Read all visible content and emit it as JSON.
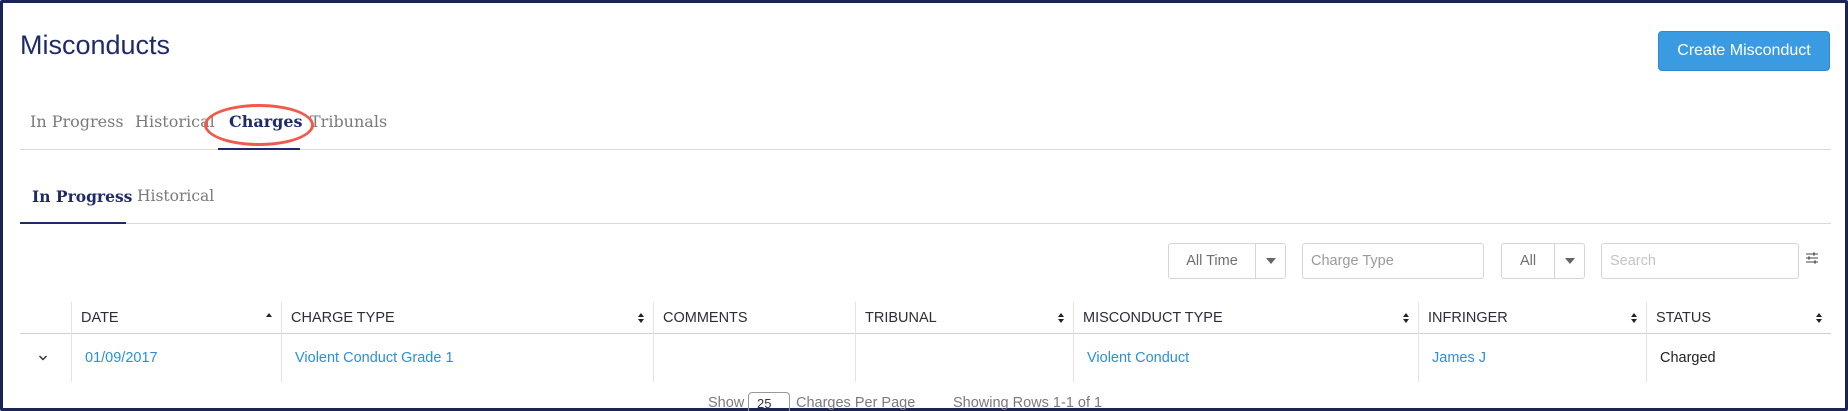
{
  "header": {
    "title": "Misconducts",
    "create_button": "Create Misconduct"
  },
  "primary_tabs": {
    "in_progress": "In Progress",
    "historical": "Historical",
    "charges": "Charges",
    "tribunals": "Tribunals",
    "active": "Charges"
  },
  "secondary_tabs": {
    "in_progress": "In Progress",
    "historical": "Historical",
    "active": "In Progress"
  },
  "filters": {
    "time_value": "All Time",
    "charge_type_placeholder": "Charge Type",
    "status_value": "All",
    "search_placeholder": "Search"
  },
  "table": {
    "columns": {
      "date": "DATE",
      "charge_type": "CHARGE TYPE",
      "comments": "COMMENTS",
      "tribunal": "TRIBUNAL",
      "misconduct_type": "MISCONDUCT TYPE",
      "infringer": "INFRINGER",
      "status": "STATUS"
    },
    "rows": [
      {
        "date": "01/09/2017",
        "charge_type": "Violent Conduct Grade 1",
        "comments": "",
        "tribunal": "",
        "misconduct_type": "Violent Conduct",
        "infringer": "James J",
        "status": "Charged"
      }
    ]
  },
  "footer": {
    "show_label": "Show",
    "per_page_value": "25",
    "per_page_label": "Charges Per Page",
    "showing_rows": "Showing Rows 1-1 of 1"
  },
  "colors": {
    "accent": "#3a9be3",
    "title": "#1f2a6b",
    "link": "#2a90d9",
    "highlight": "#ef5a4b"
  },
  "icons": {
    "sort": "sort-icon",
    "expand": "chevron-down-icon",
    "settings": "settings-sliders-icon",
    "dropdown": "caret-down-icon"
  }
}
